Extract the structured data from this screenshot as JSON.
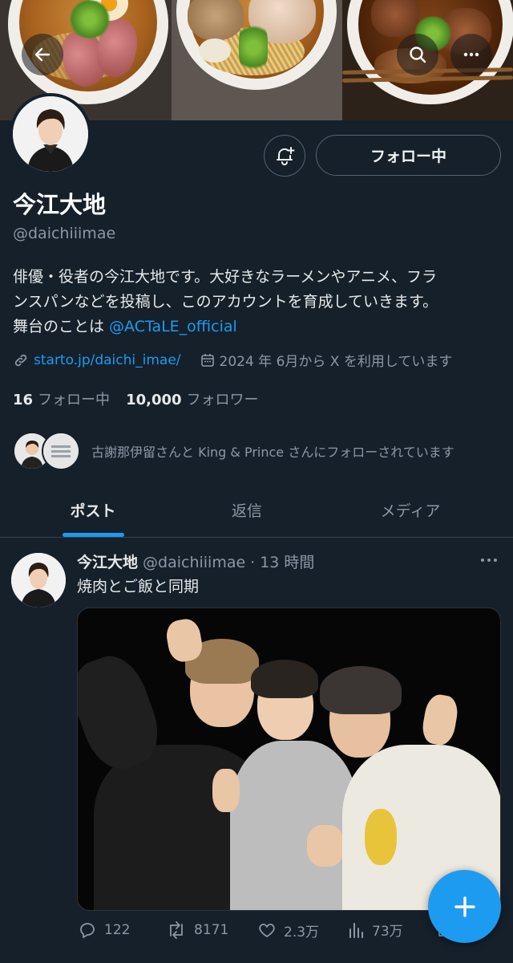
{
  "header": {
    "back_icon": "arrow-left-icon",
    "search_icon": "search-icon",
    "more_icon": "more-horizontal-icon"
  },
  "profile": {
    "display_name": "今江大地",
    "handle": "@daichiiimae",
    "follow_button_label": "フォロー中",
    "notify_icon": "bell-plus-icon",
    "bio_line1": "俳優・役者の今江大地です。大好きなラーメンやアニメ、フラ",
    "bio_line2": "ンスパンなどを投稿し、このアカウントを育成していきます。",
    "bio_line3_prefix": "舞台のことは ",
    "bio_mention": "@ACTaLE_official",
    "website": "starto.jp/daichi_imae/",
    "joined": "2024 年 6月から X を利用しています",
    "following_count": "16",
    "following_label": "フォロー中",
    "followers_count": "10,000",
    "followers_label": "フォロワー",
    "followed_by_text": "古謝那伊留さんと King & Prince さんにフォローされています"
  },
  "tabs": [
    {
      "label": "ポスト",
      "active": true
    },
    {
      "label": "返信",
      "active": false
    },
    {
      "label": "メディア",
      "active": false
    }
  ],
  "post": {
    "author_name": "今江大地",
    "author_handle": "@daichiiimae",
    "separator": "·",
    "time": "13 時間",
    "text": "焼肉とご飯と同期",
    "reply_count": "122",
    "repost_count": "8171",
    "like_count": "2.3万",
    "view_count": "73万"
  },
  "fab": {
    "icon": "plus-icon"
  },
  "colors": {
    "background": "#15202b",
    "accent": "#1d9bf0",
    "secondary_text": "#8b98a5"
  }
}
